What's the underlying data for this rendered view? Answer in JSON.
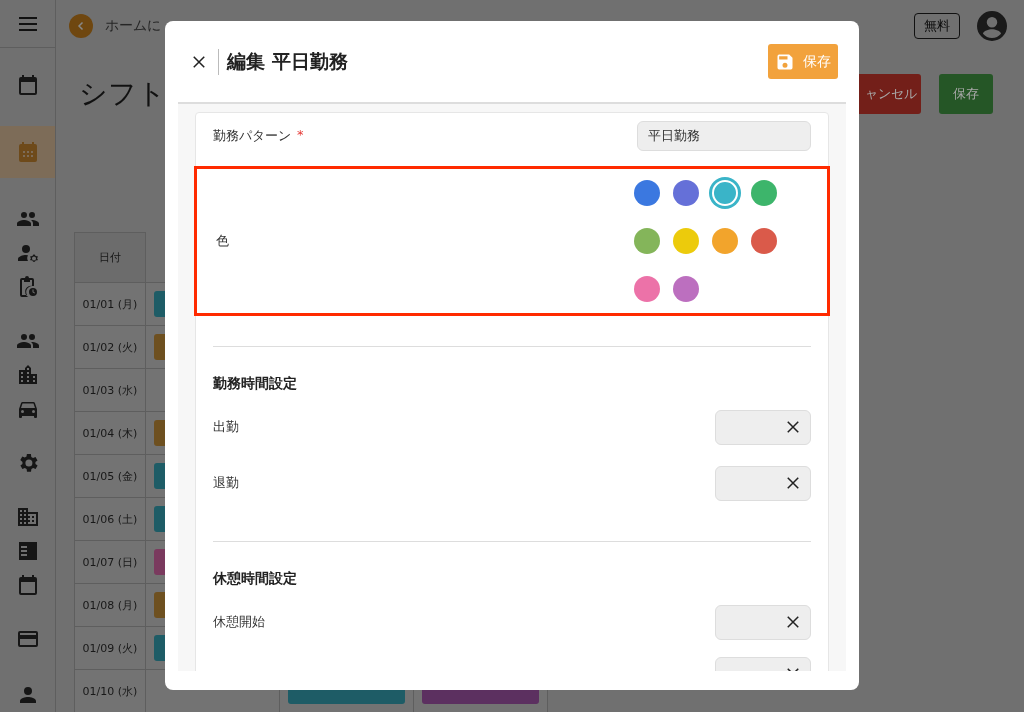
{
  "sidebar": {
    "items": [
      {
        "selected": false
      },
      {
        "selected": true
      },
      {
        "selected": false
      },
      {
        "selected": false
      },
      {
        "selected": false
      },
      {
        "selected": false
      },
      {
        "selected": false
      },
      {
        "selected": false
      },
      {
        "selected": false
      },
      {
        "selected": false
      },
      {
        "selected": false
      },
      {
        "selected": false
      },
      {
        "selected": false
      },
      {
        "selected": false
      }
    ]
  },
  "topbar": {
    "back_link": "ホームに",
    "plan_badge": "無料"
  },
  "page": {
    "title": "シフト",
    "buttons": [
      {
        "label": "ャンセル",
        "kind": "cancel"
      },
      {
        "label": "保存",
        "kind": "save"
      }
    ]
  },
  "table": {
    "columns": [
      "日付"
    ],
    "rows": [
      {
        "date": "01/01 (月)",
        "shifts": [
          {
            "color": "#1e5c66"
          }
        ]
      },
      {
        "date": "01/02 (火)",
        "shifts": [
          {
            "color": "#6e5020"
          }
        ]
      },
      {
        "date": "01/03 (水)",
        "shifts": []
      },
      {
        "date": "01/04 (木)",
        "shifts": [
          {
            "color": "#6e5020"
          }
        ]
      },
      {
        "date": "01/05 (金)",
        "shifts": [
          {
            "color": "#1e5c66"
          }
        ]
      },
      {
        "date": "01/06 (土)",
        "shifts": [
          {
            "color": "#1e5c66"
          }
        ]
      },
      {
        "date": "01/07 (日)",
        "shifts": [
          {
            "color": "#7a3a5e"
          }
        ]
      },
      {
        "date": "01/08 (月)",
        "shifts": [
          {
            "color": "#6e5020"
          }
        ]
      },
      {
        "date": "01/09 (火)",
        "shifts": [
          {
            "color": "#1e5c66"
          }
        ]
      },
      {
        "date": "01/10 (水)",
        "shifts": [
          {
            "kind": "empty"
          },
          {
            "color": "#1e5c66"
          },
          {
            "color": "#5c3060"
          }
        ]
      }
    ]
  },
  "dialog": {
    "title": "編集 平日勤務",
    "save_label": "保存",
    "pattern": {
      "label": "勤務パターン",
      "required_mark": "*",
      "value": "平日勤務"
    },
    "color": {
      "label": "色",
      "highlighted": true,
      "options": [
        {
          "color": "#3b78e0",
          "selected": false
        },
        {
          "color": "#6570d8",
          "selected": false
        },
        {
          "color": "#3ab4c8",
          "selected": true
        },
        {
          "color": "#3db56b",
          "selected": false
        },
        {
          "color": "#84b55a",
          "selected": false
        },
        {
          "color": "#eccb0c",
          "selected": false
        },
        {
          "color": "#f2a42c",
          "selected": false
        },
        {
          "color": "#da5a4a",
          "selected": false
        },
        {
          "color": "#ec72a8",
          "selected": false
        },
        {
          "color": "#bc6fbf",
          "selected": false
        }
      ]
    },
    "sections": [
      {
        "heading": "勤務時間設定",
        "fields": [
          {
            "kind": "time",
            "label": "出勤"
          },
          {
            "kind": "time",
            "label": "退勤"
          }
        ]
      },
      {
        "heading": "休憩時間設定",
        "fields": [
          {
            "kind": "time",
            "label": "休憩開始"
          },
          {
            "kind": "time"
          }
        ]
      }
    ]
  }
}
